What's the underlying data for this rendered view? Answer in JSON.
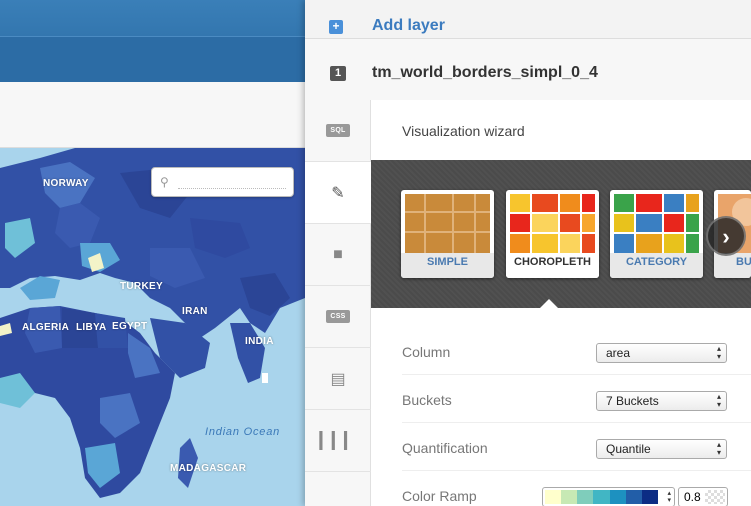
{
  "panel": {
    "add_layer_label": "Add layer",
    "layer_number": "1",
    "layer_name": "tm_world_borders_simpl_0_4",
    "wizard_title": "Visualization wizard"
  },
  "toolbar": {
    "items": [
      {
        "name": "sql",
        "label": "SQL"
      },
      {
        "name": "wizard",
        "label": ""
      },
      {
        "name": "infowindow",
        "label": ""
      },
      {
        "name": "css",
        "label": "CSS"
      },
      {
        "name": "legend",
        "label": ""
      },
      {
        "name": "filters",
        "label": ""
      }
    ]
  },
  "wizard": {
    "cards": [
      {
        "label": "SIMPLE",
        "selected": false
      },
      {
        "label": "CHOROPLETH",
        "selected": true
      },
      {
        "label": "CATEGORY",
        "selected": false
      },
      {
        "label": "BU",
        "selected": false
      }
    ],
    "next_label": "›"
  },
  "form": {
    "column": {
      "label": "Column",
      "value": "area"
    },
    "buckets": {
      "label": "Buckets",
      "value": "7 Buckets"
    },
    "quantification": {
      "label": "Quantification",
      "value": "Quantile"
    },
    "color_ramp": {
      "label": "Color Ramp",
      "opacity": "0.8",
      "colors": [
        "#ffffcc",
        "#c7e9b4",
        "#7fcdbb",
        "#41b6c4",
        "#1d91c0",
        "#225ea8",
        "#0c2c84"
      ]
    }
  },
  "map": {
    "labels": [
      "ALGERIA",
      "LIBYA",
      "EGYPT",
      "TURKEY",
      "IRAN",
      "INDIA",
      "MADAGASCAR",
      "NORWAY"
    ],
    "ocean_label": "Indian Ocean",
    "search_placeholder": ""
  },
  "colors": {
    "accent": "#3b7bbf",
    "dark_country": "#2f4aa0",
    "ocean": "#a9d4ec"
  }
}
